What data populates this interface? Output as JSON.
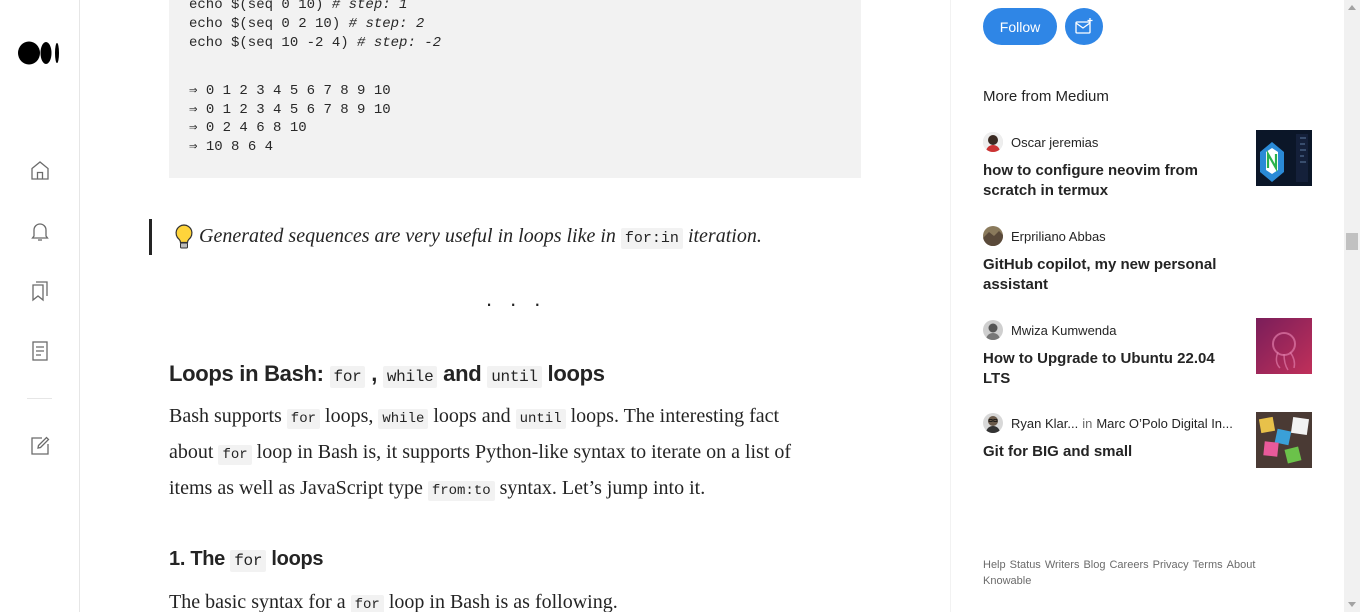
{
  "nav": {
    "logo": "medium-logo",
    "items": [
      "home-icon",
      "notifications-icon",
      "lists-icon",
      "stories-icon",
      "write-icon"
    ]
  },
  "article": {
    "code_lines": [
      {
        "cmd": "echo $(seq 0 10) ",
        "comment": "# step: 1"
      },
      {
        "cmd": "echo $(seq 0 2 10) ",
        "comment": "# step: 2"
      },
      {
        "cmd": "echo $(seq 10 -2 4) ",
        "comment": "# step: -2"
      }
    ],
    "output_lines": [
      "⇒ 0 1 2 3 4 5 6 7 8 9 10",
      "⇒ 0 1 2 3 4 5 6 7 8 9 10",
      "⇒ 0 2 4 6 8 10",
      "⇒ 10 8 6 4"
    ],
    "quote": {
      "before": "Generated sequences are very useful in loops like in ",
      "code": "for:in",
      "after": " iteration."
    },
    "separator": "...",
    "heading": {
      "t1": "Loops in Bash: ",
      "c1": "for",
      "t2": " , ",
      "c2": "while",
      "t3": " and ",
      "c3": "until",
      "t4": " loops"
    },
    "para1": {
      "l1a": "Bash supports ",
      "l1c1": "for",
      "l1b": " loops, ",
      "l1c2": "while",
      "l1d": " loops and ",
      "l1c3": "until",
      "l1e": " loops. The interesting fact",
      "l2a": "about ",
      "l2c": "for",
      "l2b": " loop in Bash is, it supports Python-like syntax to iterate on a list of",
      "l3a": "items as well as JavaScript type ",
      "l3c": "from:to",
      "l3b": " syntax. Let’s jump into it."
    },
    "subheading": {
      "t1": "1. The ",
      "c1": "for",
      "t2": " loops"
    },
    "para2": {
      "a": "The basic syntax for a ",
      "c": "for",
      "b": " loop in Bash is as following."
    }
  },
  "sidebar": {
    "follow_label": "Follow",
    "more_title": "More from Medium",
    "stories": [
      {
        "author": "Oscar jeremias",
        "publication": "",
        "title": "how to configure neovim from scratch in termux"
      },
      {
        "author": "Erpriliano Abbas",
        "publication": "",
        "title": "GitHub copilot, my new personal assistant"
      },
      {
        "author": "Mwiza Kumwenda",
        "publication": "",
        "title": "How to Upgrade to Ubuntu 22.04 LTS"
      },
      {
        "author": "Ryan Klar...",
        "in_label": "in",
        "publication": "Marc O’Polo Digital In...",
        "title": "Git for BIG and small"
      }
    ],
    "footer_links": [
      "Help",
      "Status",
      "Writers",
      "Blog",
      "Careers",
      "Privacy",
      "Terms",
      "About",
      "Knowable"
    ]
  },
  "colors": {
    "accent": "#2f86e6",
    "text": "#242424",
    "muted": "#6b6b6b",
    "code_bg": "#f2f2f2"
  }
}
